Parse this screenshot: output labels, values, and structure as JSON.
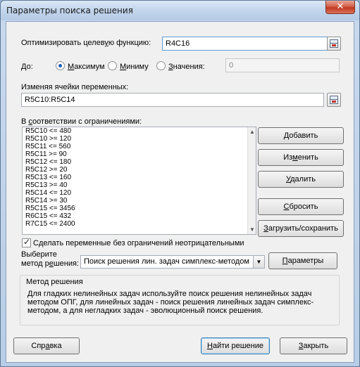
{
  "window": {
    "title": "Параметры поиска решения",
    "close_glyph": "✕"
  },
  "objective": {
    "label_prefix": "Оптимизировать целев",
    "label_underline": "у",
    "label_suffix": "ю функцию:",
    "value": "R4C16"
  },
  "to": {
    "label": "До:",
    "options": [
      {
        "prefix": "",
        "underline": "М",
        "suffix": "аксимум",
        "selected": true
      },
      {
        "prefix": "",
        "underline": "М",
        "suffix": "иниму",
        "selected": false
      },
      {
        "prefix": "",
        "underline": "З",
        "suffix": "начения:",
        "selected": false
      }
    ],
    "value_field": "0"
  },
  "changing": {
    "label_prefix": "Изменяя ячейки переменных:",
    "value": "R5C10:R5C14"
  },
  "constraints": {
    "label_prefix": "В ",
    "label_underline": "с",
    "label_suffix": "оответствии с ограничениями:",
    "items": [
      "R5C10 <= 480",
      "R5C10 >= 120",
      "R5C11 <= 560",
      "R5C11 >= 90",
      "R5C12 <= 180",
      "R5C12 >= 20",
      "R5C13 <= 160",
      "R5C13 >= 40",
      "R5C14 <= 120",
      "R5C14 >= 30",
      "R5C15 <= 3456",
      "R6C15 <= 432",
      "R7C15 <= 2400"
    ]
  },
  "buttons": {
    "add": {
      "prefix": "",
      "underline": "Д",
      "suffix": "обавить"
    },
    "change": {
      "prefix": "Из",
      "underline": "м",
      "suffix": "енить"
    },
    "delete": {
      "prefix": "",
      "underline": "У",
      "suffix": "далить"
    },
    "reset": {
      "prefix": "",
      "underline": "С",
      "suffix": "бросить"
    },
    "load_save": {
      "prefix": "",
      "underline": "З",
      "suffix": "агрузить/сохранить"
    },
    "params": {
      "prefix": "",
      "underline": "П",
      "suffix": "араметры"
    },
    "help": {
      "prefix": "Спр",
      "underline": "а",
      "suffix": "вка"
    },
    "solve": {
      "prefix": "",
      "underline": "Н",
      "suffix": "айти решение"
    },
    "close": {
      "prefix": "",
      "underline": "З",
      "suffix": "акрыть"
    }
  },
  "nonnegative": {
    "checked": true,
    "prefix": "С",
    "underline": "д",
    "suffix": "елать переменные без ограничений неотрицательными"
  },
  "method": {
    "label_line1": "Выберите",
    "label_line2_prefix": "метод р",
    "label_line2_underline": "е",
    "label_line2_suffix": "шения:",
    "selected": "Поиск решения лин. задач симплекс-методом",
    "dropdown_glyph": "▼"
  },
  "method_box": {
    "title": "Метод решения",
    "description": "Для гладких нелинейных задач используйте поиск решения нелинейных задач методом ОПГ, для линейных задач - поиск решения линейных задач симплекс-методом, а для негладких задач - эволюционный поиск решения."
  },
  "scrollbar": {
    "up_glyph": "▲",
    "down_glyph": "▼"
  }
}
